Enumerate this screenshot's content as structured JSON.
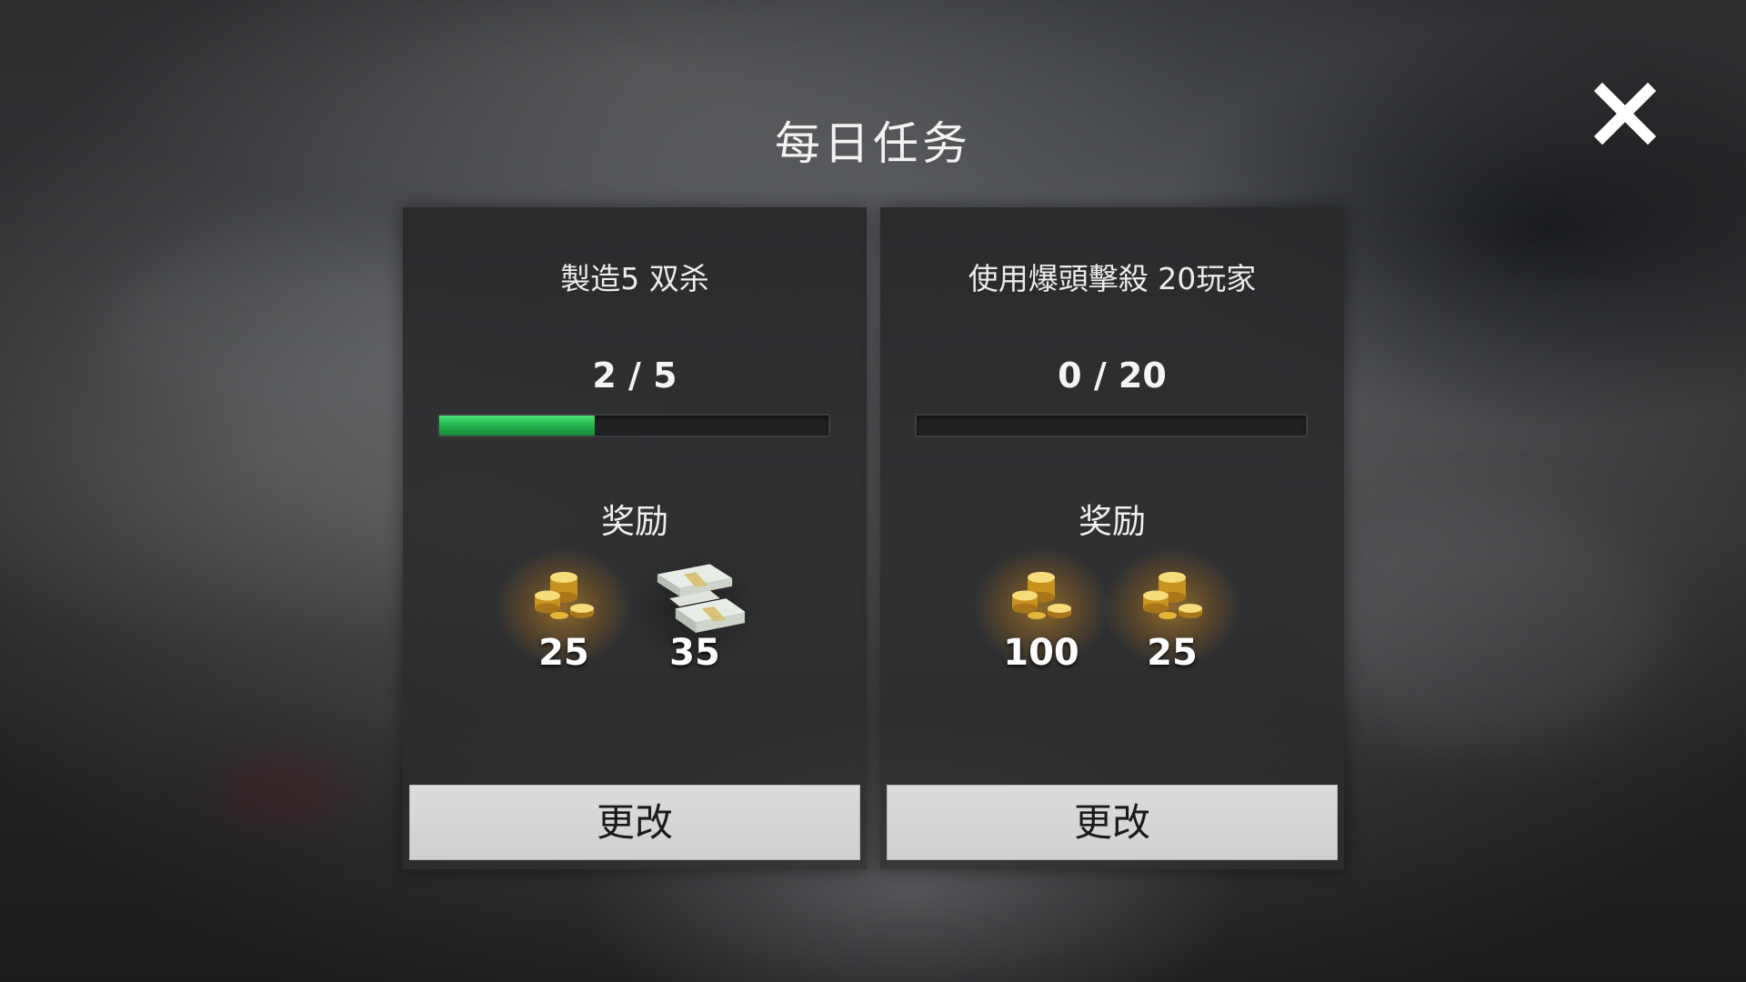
{
  "title": "每日任务",
  "close_icon": "close-icon",
  "missions": [
    {
      "task": "製造5 双杀",
      "progress_text": "2 / 5",
      "progress_current": 2,
      "progress_total": 5,
      "reward_label": "奖励",
      "rewards": [
        {
          "icon": "gold-coins-icon",
          "amount": "25"
        },
        {
          "icon": "cash-stack-icon",
          "amount": "35"
        }
      ],
      "button_label": "更改"
    },
    {
      "task": "使用爆頭擊殺 20玩家",
      "progress_text": "0 / 20",
      "progress_current": 0,
      "progress_total": 20,
      "reward_label": "奖励",
      "rewards": [
        {
          "icon": "gold-coins-icon",
          "amount": "100"
        },
        {
          "icon": "gold-coins-icon",
          "amount": "25"
        }
      ],
      "button_label": "更改"
    }
  ],
  "colors": {
    "progress_fill": "#1fb04a",
    "button_bg": "#d4d4d4",
    "coin_gold": "#e3b53a"
  }
}
